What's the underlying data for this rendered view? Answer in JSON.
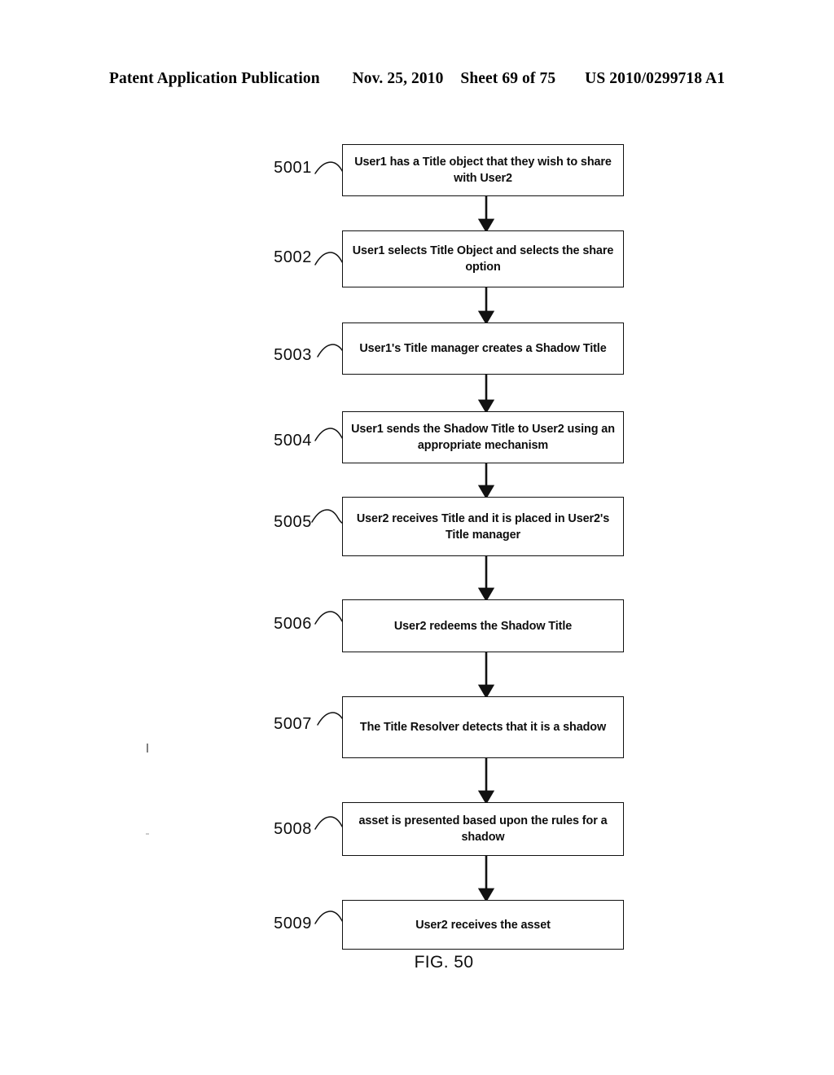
{
  "header": {
    "publication": "Patent Application Publication",
    "date": "Nov. 25, 2010",
    "sheet": "Sheet 69 of 75",
    "patent_number": "US 2010/0299718 A1"
  },
  "figure": {
    "caption": "FIG. 50"
  },
  "flowchart": {
    "type": "flowchart",
    "orientation": "top-to-bottom",
    "connector": "arrow-down",
    "nodes": [
      {
        "ref": "5001",
        "text": "User1 has a Title object that they wish to share with User2"
      },
      {
        "ref": "5002",
        "text": "User1 selects Title Object and selects the share option"
      },
      {
        "ref": "5003",
        "text": "User1's Title manager creates a Shadow Title"
      },
      {
        "ref": "5004",
        "text": "User1 sends the Shadow Title to User2 using an appropriate mechanism"
      },
      {
        "ref": "5005",
        "text": "User2 receives Title and it is placed in User2's Title manager"
      },
      {
        "ref": "5006",
        "text": "User2 redeems the Shadow Title"
      },
      {
        "ref": "5007",
        "text": "The Title Resolver detects that it is a shadow"
      },
      {
        "ref": "5008",
        "text": "asset is presented based upon the rules for a shadow"
      },
      {
        "ref": "5009",
        "text": "User2 receives the asset"
      }
    ],
    "edges": [
      {
        "from": "5001",
        "to": "5002"
      },
      {
        "from": "5002",
        "to": "5003"
      },
      {
        "from": "5003",
        "to": "5004"
      },
      {
        "from": "5004",
        "to": "5005"
      },
      {
        "from": "5005",
        "to": "5006"
      },
      {
        "from": "5006",
        "to": "5007"
      },
      {
        "from": "5007",
        "to": "5008"
      },
      {
        "from": "5008",
        "to": "5009"
      }
    ]
  },
  "colors": {
    "ink": "#111111",
    "page": "#ffffff"
  }
}
